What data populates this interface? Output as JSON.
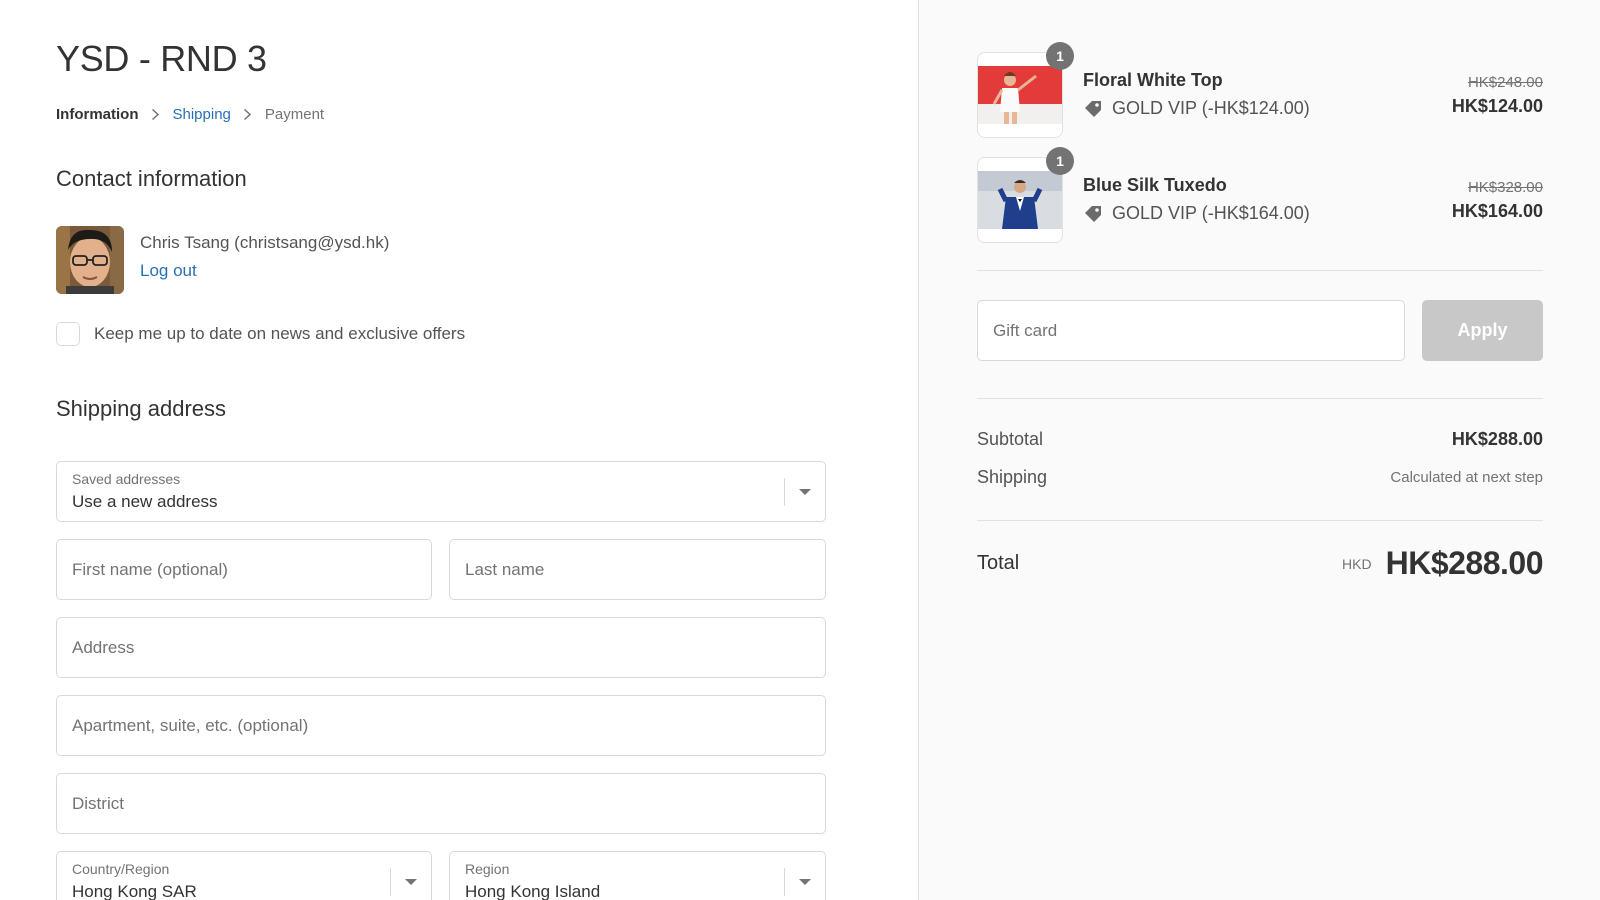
{
  "store": {
    "title": "YSD - RND 3"
  },
  "breadcrumb": {
    "items": [
      {
        "label": "Information"
      },
      {
        "label": "Shipping"
      },
      {
        "label": "Payment"
      }
    ]
  },
  "contact": {
    "title": "Contact information",
    "name_email": "Chris Tsang (christsang@ysd.hk)",
    "logout_label": "Log out",
    "newsletter_label": "Keep me up to date on news and exclusive offers",
    "newsletter_checked": false
  },
  "shipping": {
    "title": "Shipping address",
    "saved_addresses": {
      "label": "Saved addresses",
      "value": "Use a new address"
    },
    "first_name": {
      "placeholder": "First name (optional)"
    },
    "last_name": {
      "placeholder": "Last name"
    },
    "address": {
      "placeholder": "Address"
    },
    "apartment": {
      "placeholder": "Apartment, suite, etc. (optional)"
    },
    "district": {
      "placeholder": "District"
    },
    "country": {
      "label": "Country/Region",
      "value": "Hong Kong SAR"
    },
    "region": {
      "label": "Region",
      "value": "Hong Kong Island"
    }
  },
  "order": {
    "items": [
      {
        "name": "Floral White Top",
        "quantity": "1",
        "discount": "GOLD VIP (-HK$124.00)",
        "compare_price": "HK$248.00",
        "price": "HK$124.00"
      },
      {
        "name": "Blue Silk Tuxedo",
        "quantity": "1",
        "discount": "GOLD VIP (-HK$164.00)",
        "compare_price": "HK$328.00",
        "price": "HK$164.00"
      }
    ],
    "gift_card": {
      "placeholder": "Gift card",
      "apply_label": "Apply"
    },
    "subtotal": {
      "label": "Subtotal",
      "value": "HK$288.00"
    },
    "shipping_cost": {
      "label": "Shipping",
      "value": "Calculated at next step"
    },
    "total": {
      "label": "Total",
      "currency": "HKD",
      "value": "HK$288.00"
    }
  },
  "colors": {
    "link": "#2a6fb4",
    "text": "#333333",
    "muted": "#737373",
    "sidebar_bg": "#fafafa",
    "apply_disabled": "#c8c8c8"
  },
  "icons": {
    "breadcrumb_separator": "chevron-right-icon",
    "discount": "tag-icon",
    "select_caret": "chevron-down-icon"
  }
}
